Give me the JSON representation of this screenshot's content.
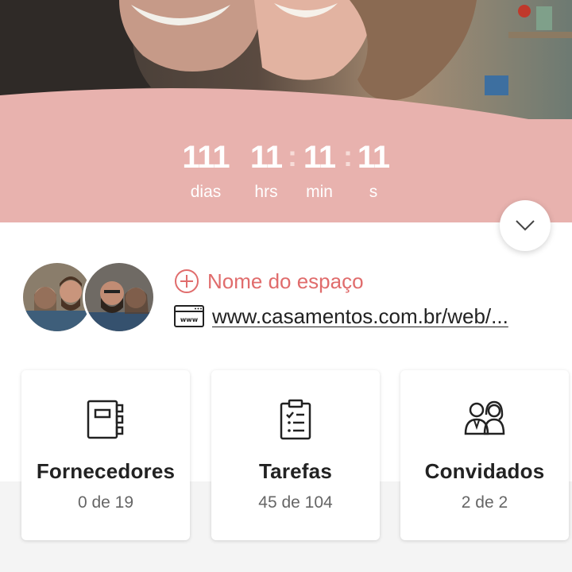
{
  "countdown": {
    "days": "111",
    "days_label": "dias",
    "hours": "11",
    "hours_label": "hrs",
    "minutes": "11",
    "minutes_label": "min",
    "seconds": "11",
    "seconds_label": "s",
    "separator": ":"
  },
  "profile": {
    "space_label": "Nome do espaço",
    "website": "www.casamentos.com.br/web/..."
  },
  "cards": [
    {
      "title": "Fornecedores",
      "progress": "0 de 19"
    },
    {
      "title": "Tarefas",
      "progress": "45 de 104"
    },
    {
      "title": "Convidados",
      "progress": "2 de 2"
    }
  ],
  "colors": {
    "banner": "#e8b2ae",
    "accent": "#e06c6c"
  }
}
